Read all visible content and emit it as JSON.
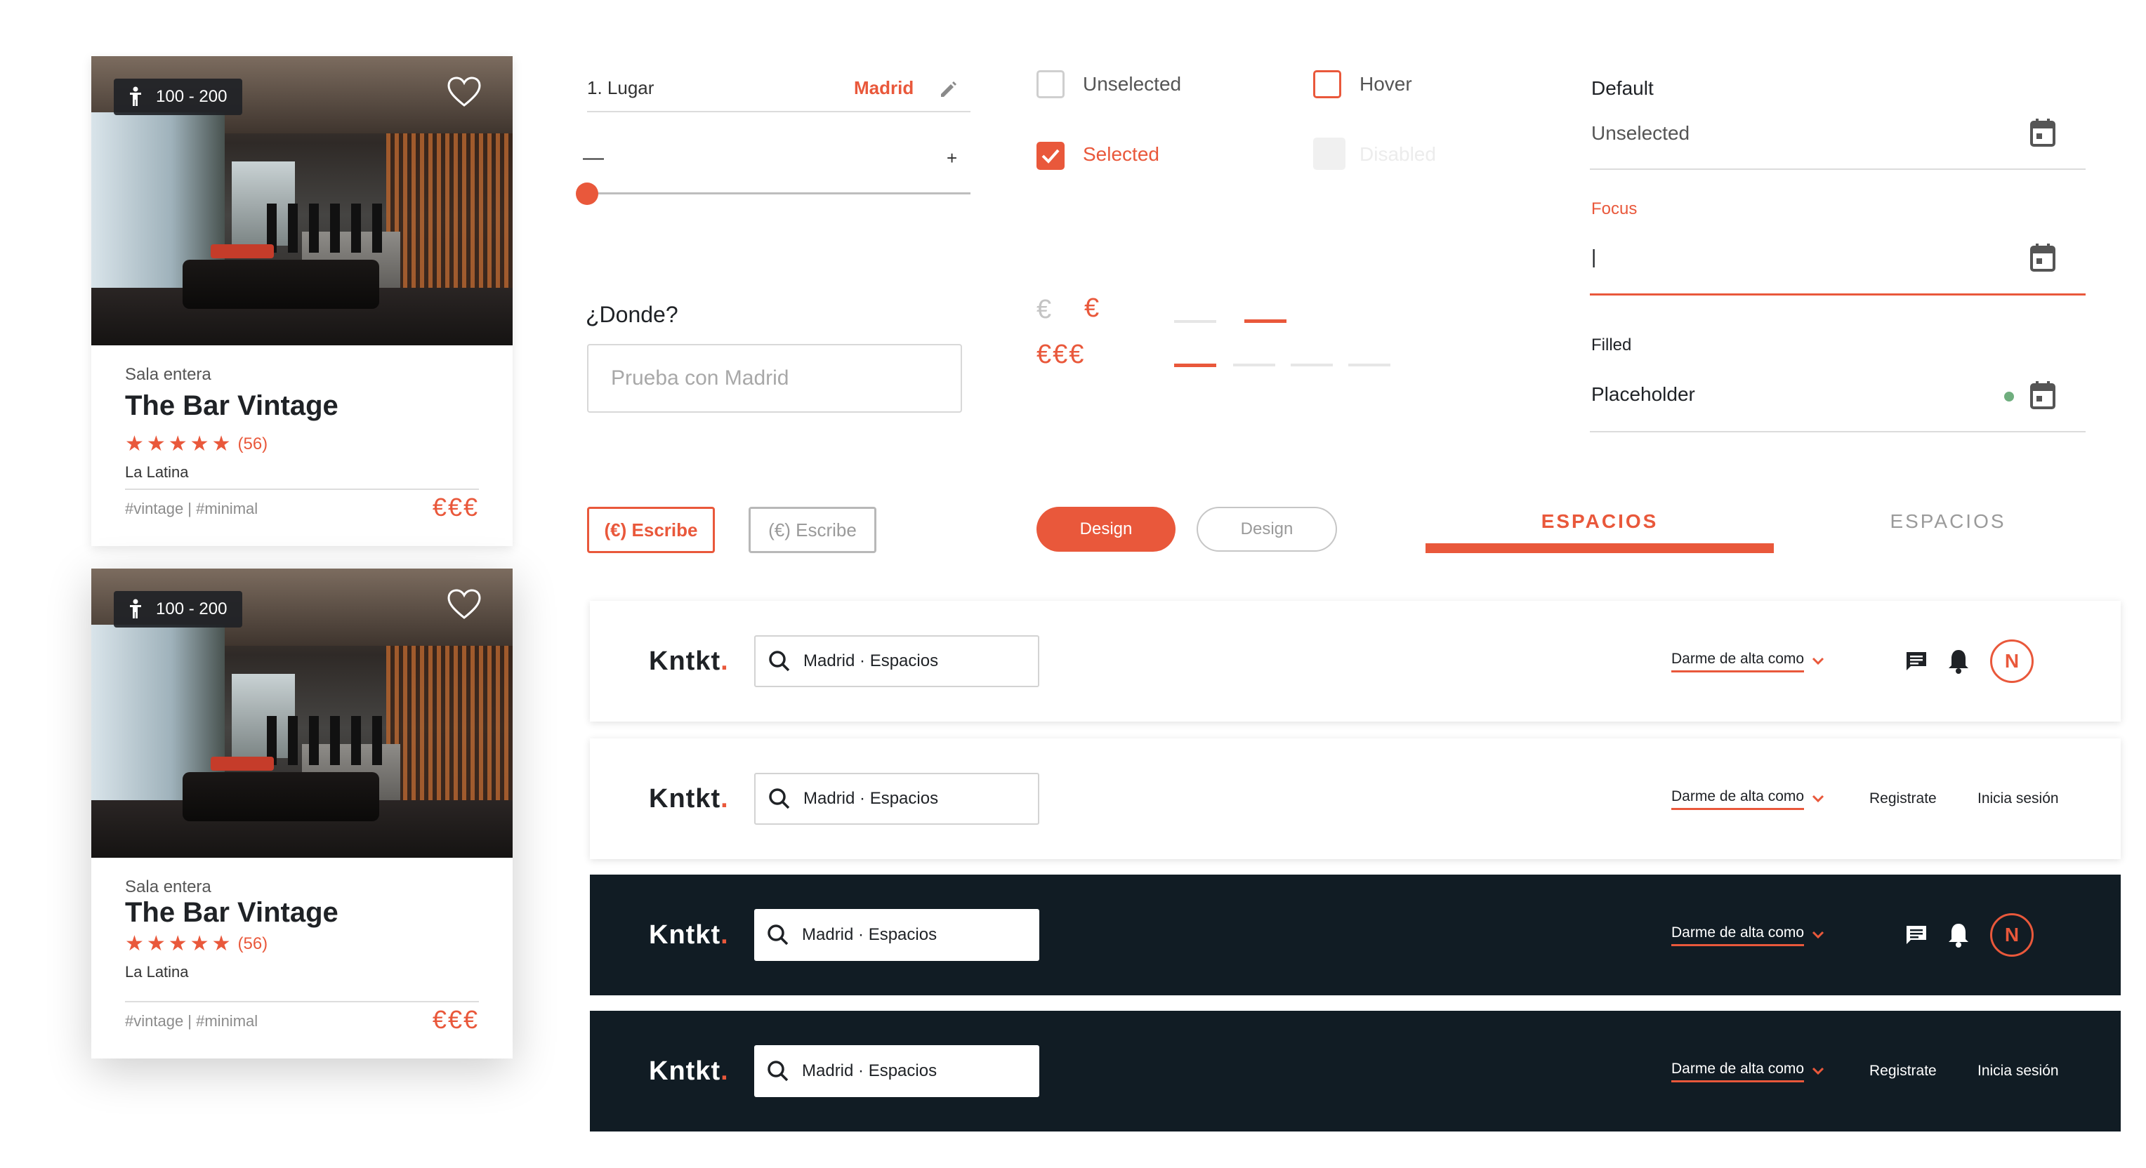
{
  "colors": {
    "accent": "#e9583b",
    "dark_header": "#111c24",
    "success_dot": "#6fae7e"
  },
  "cards": [
    {
      "capacity": "100 - 200",
      "type": "Sala entera",
      "name": "The Bar Vintage",
      "stars": "★★★★★",
      "reviews": "(56)",
      "area": "La Latina",
      "tags": "#vintage | #minimal",
      "price": "€€€"
    },
    {
      "capacity": "100 - 200",
      "type": "Sala entera",
      "name": "The Bar Vintage",
      "stars": "★★★★★",
      "reviews": "(56)",
      "area": "La Latina",
      "tags": "#vintage | #minimal",
      "price": "€€€"
    }
  ],
  "place_filter": {
    "label": "1. Lugar",
    "value": "Madrid",
    "minus": "—",
    "plus": "+"
  },
  "where": {
    "label": "¿Donde?",
    "placeholder": "Prueba con Madrid"
  },
  "checkboxes": {
    "unselected": "Unselected",
    "hover": "Hover",
    "selected": "Selected",
    "disabled": "Disabled"
  },
  "price_levels": {
    "low_inactive": "€",
    "low_active": "€",
    "high": "€€€"
  },
  "date_fields": {
    "default_title": "Default",
    "default_value": "Unselected",
    "focus_title": "Focus",
    "focus_value": "|",
    "filled_title": "Filled",
    "filled_value": "Placeholder"
  },
  "buttons": {
    "write_active": "(€) Escribe",
    "write_inactive": "(€) Escribe",
    "design_fill": "Design",
    "design_outline": "Design"
  },
  "tabs": {
    "active": "ESPACIOS",
    "inactive": "ESPACIOS"
  },
  "headers": {
    "logo_text": "Kntkt",
    "logo_dot": ".",
    "search_text": "Madrid · Espacios",
    "signup_as": "Darme de alta como",
    "register": "Registrate",
    "login": "Inicia sesión",
    "avatar_initial": "N"
  }
}
